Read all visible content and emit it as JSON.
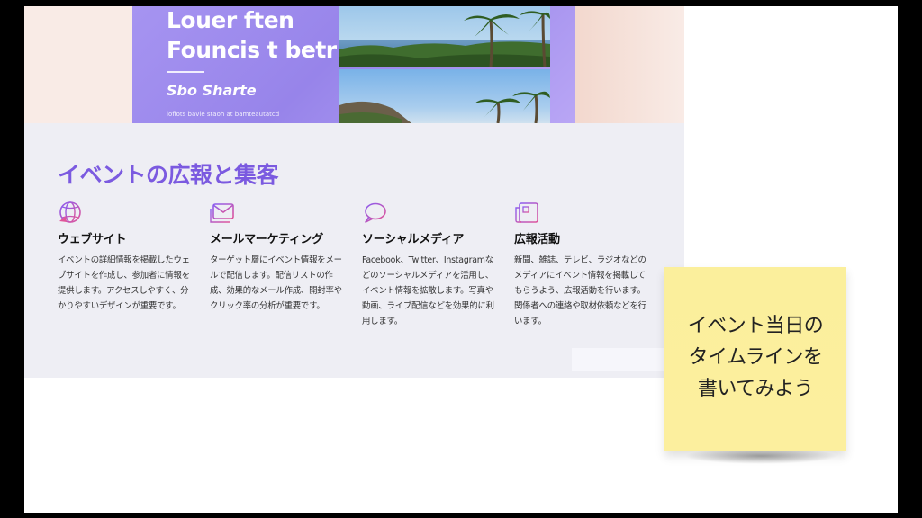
{
  "hero": {
    "poster": {
      "title_line1": "Louer ften",
      "title_line2": "Founcis t betr",
      "subtitle": "Sbo Sharte",
      "small_text": "lofiots bavie staoh at bamteautatcd"
    }
  },
  "section": {
    "title": "イベントの広報と集客",
    "features": [
      {
        "icon": "globe-icon",
        "title": "ウェブサイト",
        "description": "イベントの詳細情報を掲載したウェブサイトを作成し、参加者に情報を提供します。アクセスしやすく、分かりやすいデザインが重要です。"
      },
      {
        "icon": "mail-icon",
        "title": "メールマーケティング",
        "description": "ターゲット層にイベント情報をメールで配信します。配信リストの作成、効果的なメール作成、開封率やクリック率の分析が重要です。"
      },
      {
        "icon": "chat-bubble-icon",
        "title": "ソーシャルメディア",
        "description": "Facebook、Twitter、Instagramなどのソーシャルメディアを活用し、イベント情報を拡散します。写真や動画、ライブ配信などを効果的に利用します。"
      },
      {
        "icon": "newspaper-icon",
        "title": "広報活動",
        "description": "新聞、雑誌、テレビ、ラジオなどのメディアにイベント情報を掲載してもらうよう、広報活動を行います。関係者への連絡や取材依頼などを行います。"
      }
    ]
  },
  "sticky_note": {
    "text": "イベント当日の\nタイムラインを\n書いてみよう"
  },
  "colors": {
    "accent": "#7b5ae0",
    "band_bg": "#eeeef4",
    "hero_bg": "#f9ebe6",
    "note_bg": "#fcef9e"
  }
}
